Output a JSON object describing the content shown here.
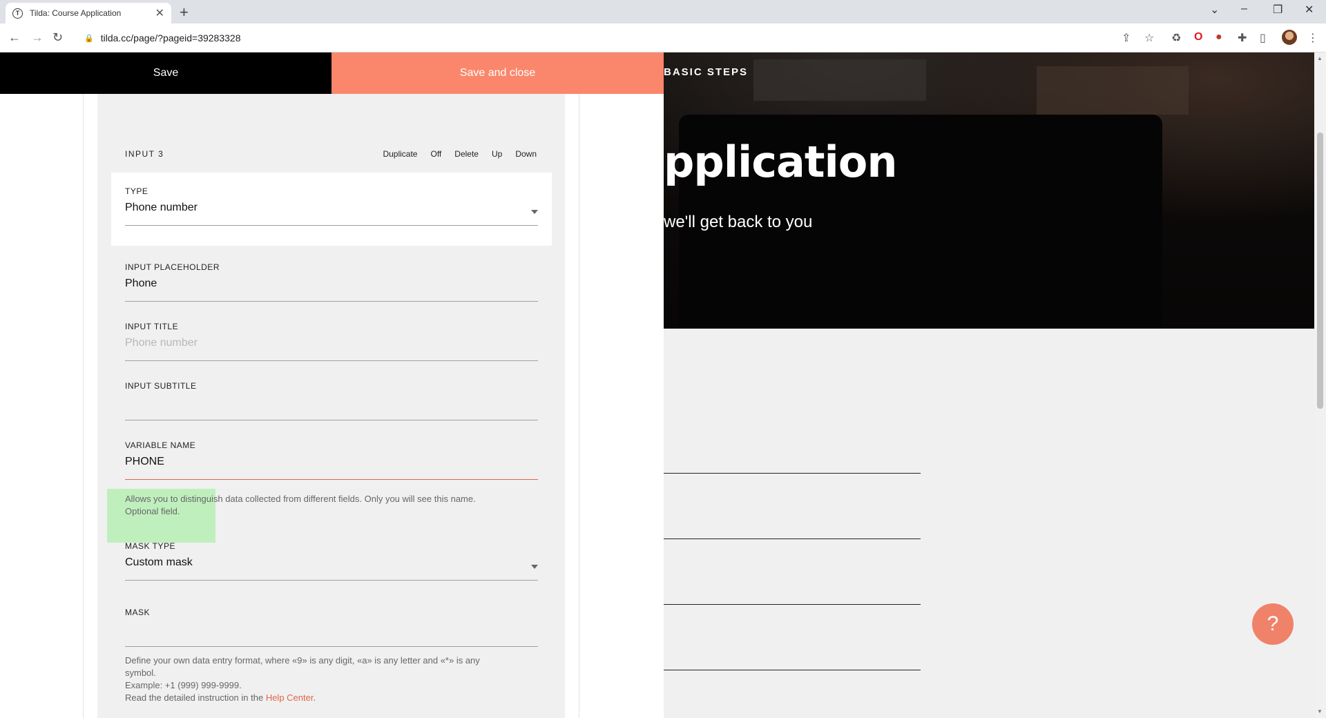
{
  "browser": {
    "tab_title": "Tilda: Course Application",
    "tab_favicon": "T",
    "tab_close": "✕",
    "new_tab": "+",
    "url": "tilda.cc/page/?pageid=39283328",
    "window_controls": {
      "dropdown": "⌄",
      "minimize": "–",
      "restore": "❐",
      "close": "✕"
    }
  },
  "editor": {
    "save_label": "Save",
    "save_close_label": "Save and close",
    "card": {
      "title": "INPUT 3",
      "actions": {
        "duplicate": "Duplicate",
        "off": "Off",
        "delete": "Delete",
        "up": "Up",
        "down": "Down"
      },
      "type": {
        "label": "TYPE",
        "value": "Phone number"
      },
      "placeholder": {
        "label": "INPUT PLACEHOLDER",
        "value": "Phone"
      },
      "input_title": {
        "label": "INPUT TITLE",
        "placeholder": "Phone number"
      },
      "input_subtitle": {
        "label": "INPUT SUBTITLE",
        "value": ""
      },
      "variable_name": {
        "label": "VARIABLE NAME",
        "value": "PHONE",
        "hint_line1": "Allows you to distinguish data collected from different fields. Only you will see this name.",
        "hint_line2": "Optional field."
      },
      "mask_type": {
        "label": "MASK TYPE",
        "value": "Custom mask"
      },
      "mask": {
        "label": "MASK",
        "value": "",
        "hint_line1": "Define your own data entry format, where «9» is any digit, «a» is any letter and «*» is any",
        "hint_line2": "symbol.",
        "hint_line3": "Example: +1 (999) 999-9999.",
        "hint_line4_prefix": "Read the detailed instruction in the ",
        "hint_link": "Help Center",
        "hint_line4_suffix": "."
      }
    }
  },
  "preview": {
    "kicker": "BASIC STEPS",
    "headline": "pplication",
    "subtitle": "we'll get back to you"
  },
  "help_button": "?",
  "colors": {
    "accent": "#fa876b",
    "highlight": "#c0efbe",
    "link": "#e06548"
  }
}
